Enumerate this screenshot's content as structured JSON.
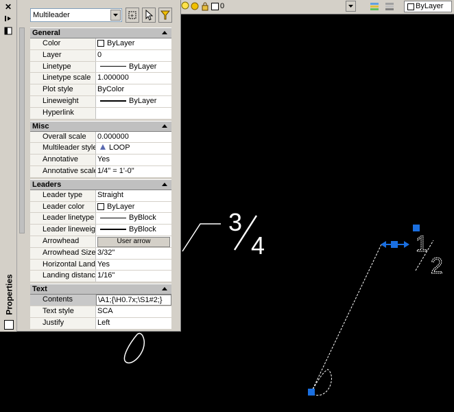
{
  "toolbar": {
    "layer_value": "0",
    "bylayer_label": "ByLayer"
  },
  "palette": {
    "title": "Properties",
    "selection": "Multileader",
    "categories": [
      {
        "name": "General",
        "rows": [
          {
            "name": "Color",
            "value": "ByLayer",
            "kind": "color"
          },
          {
            "name": "Layer",
            "value": "0",
            "kind": "text"
          },
          {
            "name": "Linetype",
            "value": "ByLayer",
            "kind": "linetype"
          },
          {
            "name": "Linetype scale",
            "value": "1.000000",
            "kind": "text"
          },
          {
            "name": "Plot style",
            "value": "ByColor",
            "kind": "text"
          },
          {
            "name": "Lineweight",
            "value": "ByLayer",
            "kind": "lineweight"
          },
          {
            "name": "Hyperlink",
            "value": "",
            "kind": "text"
          }
        ]
      },
      {
        "name": "Misc",
        "rows": [
          {
            "name": "Overall scale",
            "value": "0.000000",
            "kind": "text"
          },
          {
            "name": "Multileader style",
            "value": "LOOP",
            "kind": "style"
          },
          {
            "name": "Annotative",
            "value": "Yes",
            "kind": "text"
          },
          {
            "name": "Annotative scale",
            "value": "1/4\" = 1'-0\"",
            "kind": "text"
          }
        ]
      },
      {
        "name": "Leaders",
        "rows": [
          {
            "name": "Leader type",
            "value": "Straight",
            "kind": "text"
          },
          {
            "name": "Leader color",
            "value": "ByLayer",
            "kind": "color"
          },
          {
            "name": "Leader linetype",
            "value": "ByBlock",
            "kind": "linetype"
          },
          {
            "name": "Leader lineweight",
            "value": "ByBlock",
            "kind": "lineweight"
          },
          {
            "name": "Arrowhead",
            "value": "User arrow",
            "kind": "button"
          },
          {
            "name": "Arrowhead Size",
            "value": "3/32\"",
            "kind": "text"
          },
          {
            "name": "Horizontal Landing",
            "value": "Yes",
            "kind": "text"
          },
          {
            "name": "Landing distance",
            "value": "1/16\"",
            "kind": "text"
          }
        ]
      },
      {
        "name": "Text",
        "rows": [
          {
            "name": "Contents",
            "value": "\\A1;{\\H0.7x;\\S1#2;}",
            "kind": "text",
            "highlight": true
          },
          {
            "name": "Text style",
            "value": "SCA",
            "kind": "text"
          },
          {
            "name": "Justify",
            "value": "Left",
            "kind": "text"
          }
        ]
      }
    ]
  },
  "drawing": {
    "fraction_a_num": "3",
    "fraction_a_den": "4",
    "fraction_b_num": "1",
    "fraction_b_den": "2"
  },
  "colors": {
    "canvas_bg": "#000000",
    "grip_blue": "#1a6fe0",
    "panel_gray": "#d4d0c8"
  }
}
